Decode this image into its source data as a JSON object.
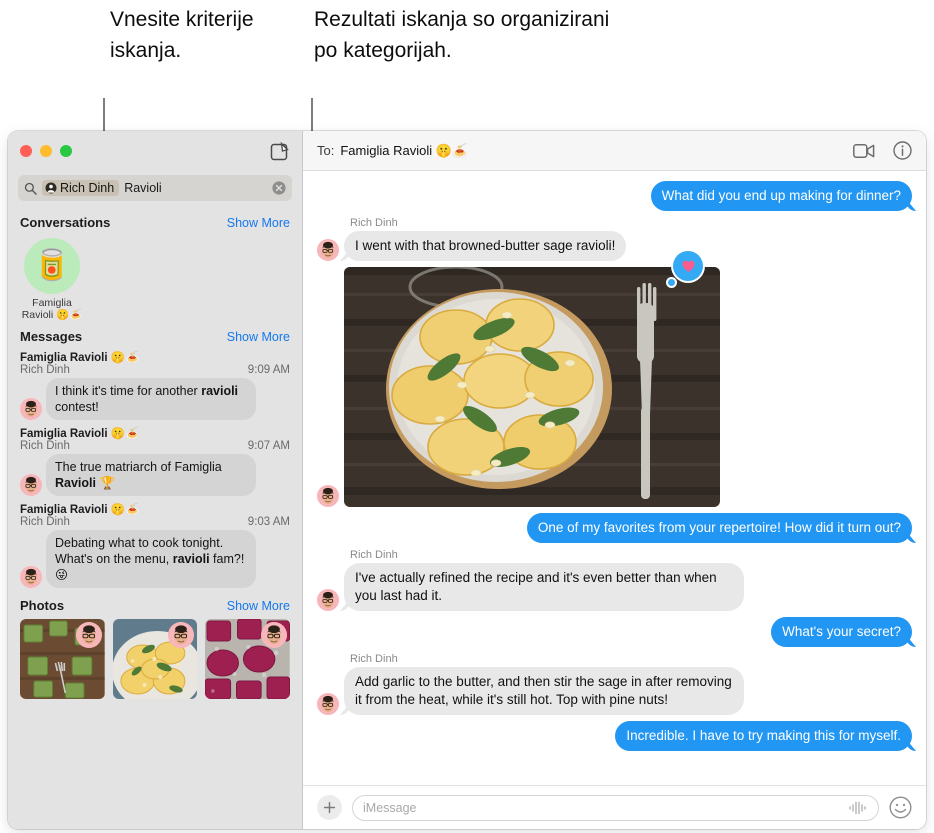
{
  "callouts": {
    "left": "Vnesite kriterije iskanja.",
    "right": "Rezultati iskanja so organizirani po kategorijah."
  },
  "colors": {
    "accent_blue": "#1478f0",
    "bubble_out": "#2196f3",
    "bubble_in": "#e8e8e8",
    "sidebar_bg": "#e3e3e3",
    "reaction_blue": "#34aaf5",
    "heart_pink": "#f95d8f",
    "traffic_red": "#ff5f57",
    "traffic_yellow": "#febc2e",
    "traffic_green": "#28c840"
  },
  "window": {
    "traffic_lights": [
      "close",
      "minimize",
      "zoom"
    ],
    "compose_icon": "compose-icon"
  },
  "search": {
    "icon": "search-icon",
    "token": {
      "icon": "person-circle-icon",
      "label": "Rich Dinh"
    },
    "text": "Ravioli",
    "clear_icon": "clear-circle-icon"
  },
  "sections": {
    "conversations": {
      "title": "Conversations",
      "show_more": "Show More",
      "items": [
        {
          "avatar_emoji": "🥫",
          "name": "Famiglia Ravioli 🤫🍝"
        }
      ]
    },
    "messages": {
      "title": "Messages",
      "show_more": "Show More",
      "items": [
        {
          "conversation": "Famiglia Ravioli 🤫🍝",
          "sender": "Rich Dinh",
          "time": "9:09 AM",
          "text_before": "I think it's time for another ",
          "highlight": "ravioli",
          "text_after": " contest!"
        },
        {
          "conversation": "Famiglia Ravioli 🤫🍝",
          "sender": "Rich Dinh",
          "time": "9:07 AM",
          "text_before": "The true matriarch of Famiglia ",
          "highlight": "Ravioli",
          "text_after": " 🏆"
        },
        {
          "conversation": "Famiglia Ravioli 🤫🍝",
          "sender": "Rich Dinh",
          "time": "9:03 AM",
          "text_before": "Debating what to cook tonight. What's on the menu, ",
          "highlight": "ravioli",
          "text_after": " fam?! 😜"
        }
      ]
    },
    "photos": {
      "title": "Photos",
      "show_more": "Show More",
      "items": [
        {
          "alt": "green-spinach-ravioli-on-wood"
        },
        {
          "alt": "yellow-ravioli-with-sage"
        },
        {
          "alt": "beet-red-ravioli-on-tray"
        }
      ]
    }
  },
  "thread": {
    "to_label": "To:",
    "to_name": "Famiglia Ravioli 🤫🍝",
    "facetime_icon": "video-camera-icon",
    "info_icon": "info-circle-icon",
    "messages": [
      {
        "dir": "out",
        "text": "What did you end up making for dinner?"
      },
      {
        "dir": "in",
        "sender": "Rich Dinh",
        "text": "I went with that browned-butter sage ravioli!"
      },
      {
        "dir": "in",
        "type": "image",
        "sender": "",
        "alt": "plate-of-sage-butter-ravioli-with-fork",
        "reaction": "heart"
      },
      {
        "dir": "out",
        "text": "One of my favorites from your repertoire! How did it turn out?"
      },
      {
        "dir": "in",
        "sender": "Rich Dinh",
        "text": "I've actually refined the recipe and it's even better than when you last had it."
      },
      {
        "dir": "out",
        "text": "What's your secret?"
      },
      {
        "dir": "in",
        "sender": "Rich Dinh",
        "text": "Add garlic to the butter, and then stir the sage in after removing it from the heat, while it's still hot. Top with pine nuts!"
      },
      {
        "dir": "out",
        "text": "Incredible. I have to try making this for myself."
      }
    ]
  },
  "composer": {
    "plus_icon": "plus-icon",
    "placeholder": "iMessage",
    "value": "",
    "audio_icon": "audio-waveform-icon",
    "emoji_icon": "emoji-smiley-icon"
  }
}
